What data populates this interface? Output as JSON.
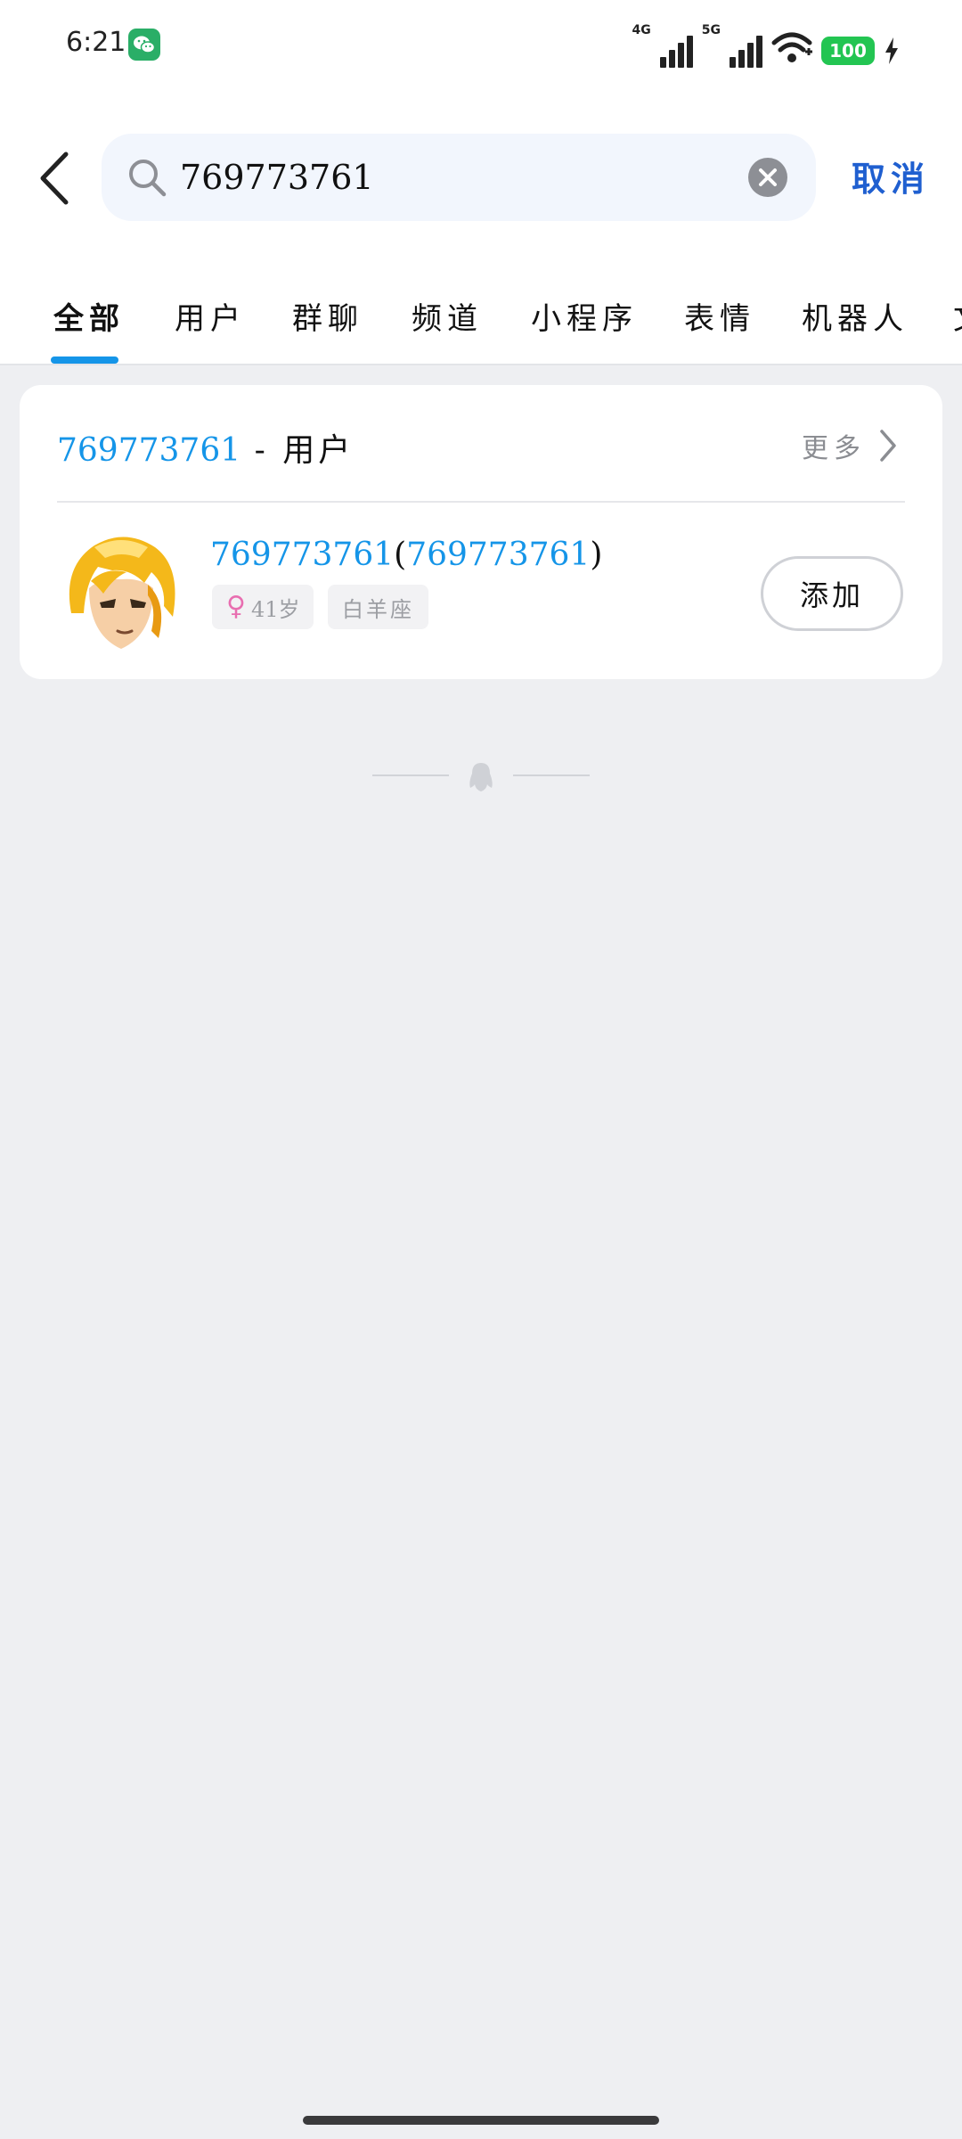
{
  "status_bar": {
    "time": "6:21",
    "network_1": "4G",
    "network_2": "5G",
    "battery": "100"
  },
  "search": {
    "query": "769773761",
    "cancel_label": "取消"
  },
  "tabs": [
    {
      "label": "全部",
      "active": true
    },
    {
      "label": "用户",
      "active": false
    },
    {
      "label": "群聊",
      "active": false
    },
    {
      "label": "频道",
      "active": false
    },
    {
      "label": "小程序",
      "active": false
    },
    {
      "label": "表情",
      "active": false
    },
    {
      "label": "机器人",
      "active": false
    },
    {
      "label": "文章",
      "active": false
    }
  ],
  "results": {
    "section_keyword": "769773761",
    "section_suffix": " - 用户",
    "more_label": "更多",
    "user": {
      "nickname": "769773761",
      "paren_open": "(",
      "qq_number": "769773761",
      "paren_close": ")",
      "age": "41岁",
      "zodiac": "白羊座",
      "add_label": "添加"
    }
  },
  "colors": {
    "accent": "#1595e8",
    "cancel": "#1f5fd0",
    "battery": "#23c552",
    "female": "#e86eb0"
  }
}
